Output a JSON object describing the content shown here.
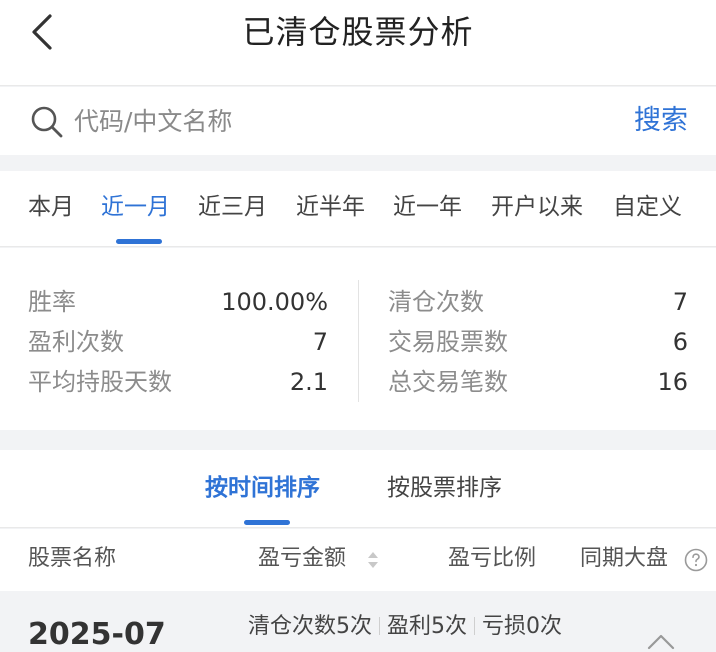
{
  "header": {
    "title": "已清仓股票分析"
  },
  "search": {
    "placeholder": "代码/中文名称",
    "button_label": "搜索"
  },
  "period_tabs": [
    {
      "label": "本月",
      "active": false
    },
    {
      "label": "近一月",
      "active": true
    },
    {
      "label": "近三月",
      "active": false
    },
    {
      "label": "近半年",
      "active": false
    },
    {
      "label": "近一年",
      "active": false
    },
    {
      "label": "开户以来",
      "active": false
    },
    {
      "label": "自定义",
      "active": false
    }
  ],
  "stats": {
    "left": [
      {
        "label": "胜率",
        "value": "100.00%"
      },
      {
        "label": "盈利次数",
        "value": "7"
      },
      {
        "label": "平均持股天数",
        "value": "2.1"
      }
    ],
    "right": [
      {
        "label": "清仓次数",
        "value": "7"
      },
      {
        "label": "交易股票数",
        "value": "6"
      },
      {
        "label": "总交易笔数",
        "value": "16"
      }
    ]
  },
  "sort_tabs": [
    {
      "label": "按时间排序",
      "active": true
    },
    {
      "label": "按股票排序",
      "active": false
    }
  ],
  "columns": [
    "股票名称",
    "盈亏金额",
    "盈亏比例",
    "同期大盘"
  ],
  "groups": [
    {
      "month": "2025-07",
      "clear_count": "清仓次数5次",
      "profit_count": "盈利5次",
      "loss_count": "亏损0次"
    }
  ],
  "colors": {
    "accent": "#2f73d6"
  }
}
